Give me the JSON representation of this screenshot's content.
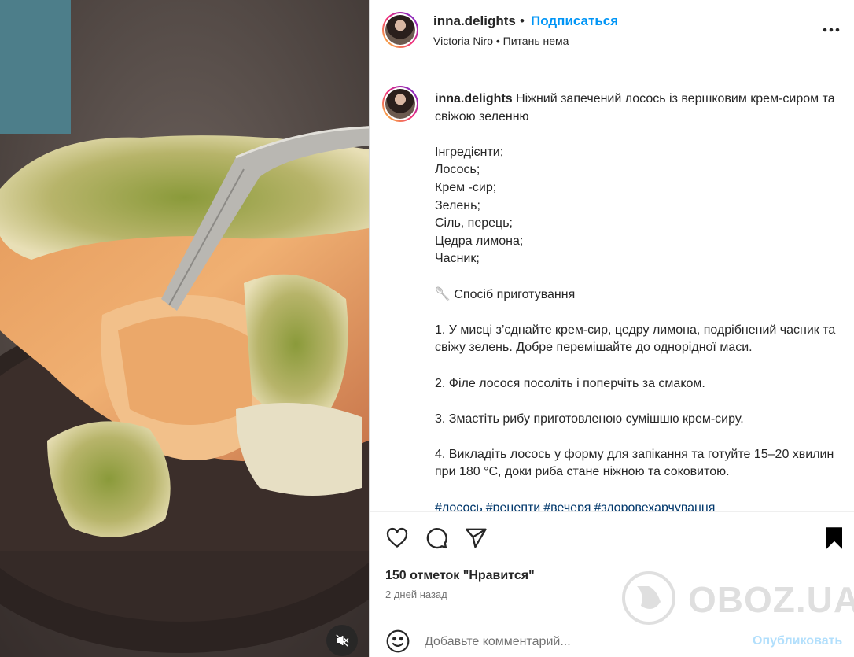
{
  "post": {
    "username": "inna.delights",
    "follow_label": "Подписаться",
    "dot": "•",
    "subtitle": "Victoria Niro • Питань нема"
  },
  "caption": {
    "username": "inna.delights",
    "title": "Ніжний запечений лосось із вершковим крем-сиром та свіжою зеленню",
    "ingredients_heading": "Інгредієнти;",
    "ingredients": [
      "Лосось;",
      "Крем -сир;",
      "Зелень;",
      "Сіль, перець;",
      "Цедра лимона;",
      "Часник;"
    ],
    "method_heading": "🥄 Спосіб приготування",
    "steps": [
      "1. У мисці з’єднайте крем-сир, цедру лимона, подрібнений часник та свіжу зелень. Добре перемішайте до однорідної маси.",
      "2. Філе лосося посоліть і поперчіть за смаком.",
      "3. Змастіть рибу приготовленою сумішшю крем-сиру.",
      "4. Викладіть лосось у форму для запікання та готуйте 15–20 хвилин при 180 °C, доки риба стане ніжною та соковитою."
    ],
    "hashtags": [
      "#лосось",
      "#рецепти",
      "#вечеря",
      "#здоровехарчування"
    ]
  },
  "engagement": {
    "likes": "150 отметок \"Нравится\"",
    "time": "2 дней назад"
  },
  "comment": {
    "placeholder": "Добавьте комментарий...",
    "publish_label": "Опубликовать"
  },
  "watermark": "OBOZ.UA",
  "icons": {
    "like": "heart-icon",
    "comment": "comment-icon",
    "share": "paper-plane-icon",
    "save": "bookmark-icon",
    "more": "more-options-icon",
    "emoji": "emoji-icon",
    "mute": "muted-speaker-icon"
  },
  "colors": {
    "link_blue": "#0095f6",
    "hashtag": "#00376b",
    "publish_disabled": "#b2dffc",
    "text": "#262626",
    "muted": "#737373"
  }
}
